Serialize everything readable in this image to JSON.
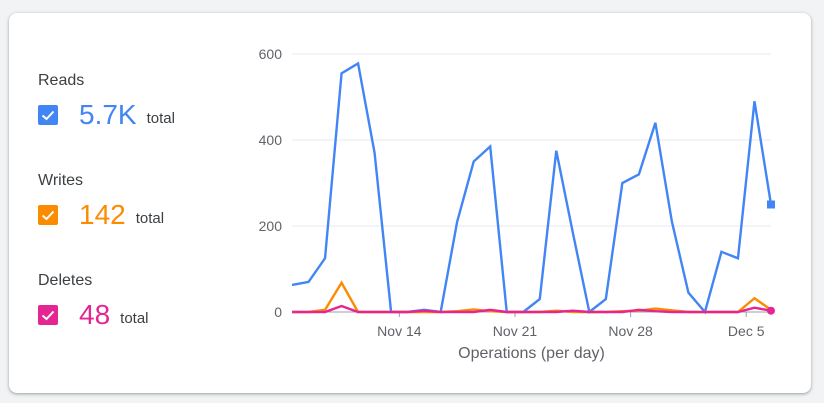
{
  "metrics": [
    {
      "label": "Reads",
      "value": "5.7K",
      "unit": "total",
      "color": "#4285f4",
      "checked": true,
      "check_icon": "checkmark-icon"
    },
    {
      "label": "Writes",
      "value": "142",
      "unit": "total",
      "color": "#fb8c00",
      "checked": true,
      "check_icon": "checkmark-icon"
    },
    {
      "label": "Deletes",
      "value": "48",
      "unit": "total",
      "color": "#e52592",
      "checked": true,
      "check_icon": "checkmark-icon"
    }
  ],
  "chart_data": {
    "type": "line",
    "title": "",
    "xlabel": "Operations (per day)",
    "ylabel": "",
    "x_tick_labels": [
      "Nov 14",
      "Nov 21",
      "Nov 28",
      "Dec 5"
    ],
    "x_tick_positions": [
      6,
      13,
      20,
      27
    ],
    "y_ticks": [
      0,
      200,
      400,
      600
    ],
    "ylim": [
      0,
      600
    ],
    "xlim": [
      -0.5,
      28.5
    ],
    "x": [
      -0.5,
      0.5,
      1.5,
      2.5,
      3.5,
      4.5,
      5.5,
      6.5,
      7.5,
      8.5,
      9.5,
      10.5,
      11.5,
      12.5,
      13.5,
      14.5,
      15.5,
      16.5,
      17.5,
      18.5,
      19.5,
      20.5,
      21.5,
      22.5,
      23.5,
      24.5,
      25.5,
      26.5,
      27.5,
      28.5
    ],
    "grid": true,
    "legend": "none",
    "series": [
      {
        "name": "Reads",
        "color": "#4285f4",
        "end_marker": "square",
        "values": [
          63,
          70,
          125,
          555,
          578,
          370,
          0,
          0,
          5,
          0,
          210,
          350,
          385,
          0,
          0,
          30,
          375,
          185,
          0,
          30,
          300,
          320,
          440,
          210,
          45,
          0,
          140,
          125,
          490,
          250
        ]
      },
      {
        "name": "Writes",
        "color": "#fb8c00",
        "end_marker": "none",
        "values": [
          0,
          0,
          5,
          68,
          0,
          0,
          0,
          0,
          0,
          0,
          2,
          6,
          2,
          0,
          0,
          0,
          3,
          0,
          0,
          0,
          2,
          3,
          8,
          4,
          0,
          0,
          0,
          0,
          32,
          5
        ]
      },
      {
        "name": "Deletes",
        "color": "#e52592",
        "end_marker": "circle",
        "values": [
          0,
          0,
          0,
          14,
          0,
          0,
          0,
          0,
          3,
          0,
          0,
          0,
          5,
          0,
          0,
          0,
          0,
          3,
          0,
          0,
          0,
          5,
          2,
          0,
          0,
          0,
          0,
          0,
          10,
          3
        ]
      }
    ]
  }
}
